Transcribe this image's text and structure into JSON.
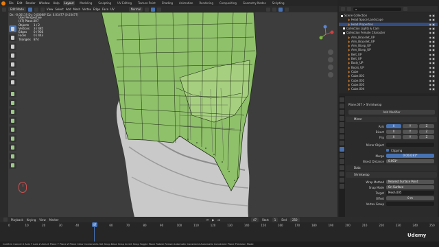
{
  "menu": {
    "items": [
      "File",
      "Edit",
      "Render",
      "Window",
      "Help"
    ],
    "workspaces": [
      "Layout",
      "Modeling",
      "Sculpting",
      "UV Editing",
      "Texture Paint",
      "Shading",
      "Animation",
      "Rendering",
      "Compositing",
      "Geometry Nodes",
      "Scripting"
    ],
    "active_workspace": "Layout",
    "scene_label": "Scene",
    "view_layer_label": "ViewLayer"
  },
  "viewport_header": {
    "mode": "Edit Mode",
    "menus": [
      "View",
      "Select",
      "Add",
      "Mesh",
      "Vertex",
      "Edge",
      "Face",
      "UV"
    ],
    "orientation": "Normal"
  },
  "viewport": {
    "coord_readout": "Dx: -0.00119  Dy: 0.00088*  Dz: 0.03477 (0.03477)",
    "perspective": "User Perspective",
    "object_name": "(47) Plane.007",
    "stats": [
      {
        "label": "Objects",
        "value": "1 / 2"
      },
      {
        "label": "Vertices",
        "value": "3 / 485"
      },
      {
        "label": "Edges",
        "value": "0 / 936"
      },
      {
        "label": "Faces",
        "value": "0 / 443"
      },
      {
        "label": "Triangles",
        "value": "874"
      }
    ]
  },
  "outliner": {
    "rows": [
      {
        "label": "Scene Collection",
        "kind": "col"
      },
      {
        "label": "Head Space Landscape",
        "kind": "obj"
      },
      {
        "label": "Head Properties",
        "kind": "obj"
      },
      {
        "label": "Collection Lights & Cam",
        "kind": "col"
      },
      {
        "label": "Collection Female Character",
        "kind": "col"
      },
      {
        "label": "Arm_Bracelet_UP",
        "kind": "obj"
      },
      {
        "label": "Arm_Bracelet_UP",
        "kind": "obj"
      },
      {
        "label": "Arm_Bicep_UP",
        "kind": "obj"
      },
      {
        "label": "Arm_Bicep_UP",
        "kind": "obj"
      },
      {
        "label": "Belt_UP",
        "kind": "obj"
      },
      {
        "label": "Belt_UP",
        "kind": "obj"
      },
      {
        "label": "Body_UP",
        "kind": "obj"
      },
      {
        "label": "Boots_UP",
        "kind": "obj"
      },
      {
        "label": "Cube",
        "kind": "obj"
      },
      {
        "label": "Cube.001",
        "kind": "obj"
      },
      {
        "label": "Cube.002",
        "kind": "obj"
      },
      {
        "label": "Cube.003",
        "kind": "obj"
      },
      {
        "label": "Cube.004",
        "kind": "obj"
      }
    ]
  },
  "properties": {
    "breadcrumb": "Plane.007  >  Shrinkwrap",
    "add_modifier": "Add Modifier",
    "mirror": {
      "name": "Mirror",
      "axis_label": "Axis",
      "bisect_label": "Bisect",
      "flip_label": "Flip",
      "axes": [
        "X",
        "Y",
        "Z"
      ],
      "mirror_object_label": "Mirror Object",
      "clipping_label": "Clipping",
      "merge_label": "Merge",
      "merge_value": "0.003281*",
      "bisect_distance_label": "Bisect Distance",
      "bisect_distance_value": "0.001*"
    },
    "data_label": "Data",
    "shrinkwrap": {
      "name": "Shrinkwrap",
      "wrap_method_label": "Wrap Method",
      "wrap_method": "Nearest Surface Point",
      "snap_mode_label": "Snap Mode",
      "snap_mode": "On Surface",
      "target_label": "Target",
      "target": "Mesh.005",
      "offset_label": "Offset",
      "offset": "0 m",
      "vertex_group_label": "Vertex Group"
    }
  },
  "timeline": {
    "menus": [
      "Playback",
      "Keying",
      "View",
      "Marker"
    ],
    "current_frame": "47",
    "start_label": "Start",
    "start": "1",
    "end_label": "End",
    "end": "250",
    "ticks": [
      "0",
      "10",
      "20",
      "30",
      "40",
      "50",
      "60",
      "70",
      "80",
      "90",
      "100",
      "110",
      "120",
      "130",
      "140",
      "150",
      "160",
      "170",
      "180",
      "190",
      "200",
      "210",
      "220",
      "230",
      "240",
      "250"
    ]
  },
  "status_bar": "Confirm   Cancel   X Axis   Y Axis   Z Axis   X Plane   Y Plane   Z Plane   Clear Constraints   Set Snap Base   Snap Invert   Snap Toggle   Move   Rotate   Resize   Automatic Constraint   Automatic Constraint Plane   Precision Mode",
  "watermark": "Udemy",
  "colors": {
    "accent": "#4772b3",
    "mesh_green": "#8fc06a",
    "wire": "#1c2a14"
  }
}
